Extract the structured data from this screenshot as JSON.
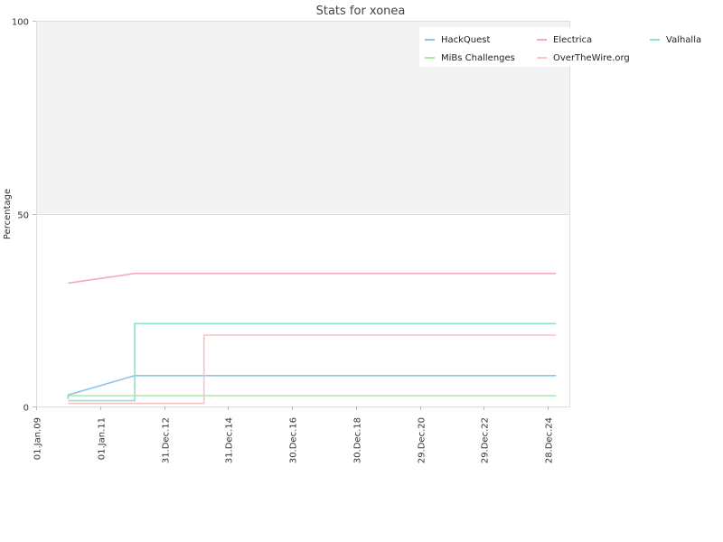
{
  "chart_data": {
    "type": "line",
    "title": "Stats for xonea",
    "xlabel": "",
    "ylabel": "Percentage",
    "ylim": [
      0,
      100
    ],
    "xlim": [
      "2009-01-01",
      "2025-09-01"
    ],
    "y_ticks": [
      0,
      50,
      100
    ],
    "x_ticks": [
      {
        "label": "01.Jan.09",
        "date": "2009-01-01"
      },
      {
        "label": "01.Jan.11",
        "date": "2011-01-01"
      },
      {
        "label": "31.Dec.12",
        "date": "2012-12-31"
      },
      {
        "label": "31.Dec.14",
        "date": "2014-12-31"
      },
      {
        "label": "30.Dec.16",
        "date": "2016-12-30"
      },
      {
        "label": "30.Dec.18",
        "date": "2018-12-30"
      },
      {
        "label": "29.Dec.20",
        "date": "2020-12-29"
      },
      {
        "label": "29.Dec.22",
        "date": "2022-12-29"
      },
      {
        "label": "28.Dec.24",
        "date": "2024-12-28"
      }
    ],
    "shaded_band": {
      "y_from": 50,
      "y_to": 100,
      "color": "#f3f3f3"
    },
    "grid": true,
    "legend_position": "top-right",
    "series": [
      {
        "name": "HackQuest",
        "color": "#8ec3ec",
        "step": false,
        "points": [
          [
            "2010-01-01",
            2
          ],
          [
            "2010-01-01",
            3
          ],
          [
            "2012-02-01",
            8
          ],
          [
            "2025-04-01",
            8
          ]
        ]
      },
      {
        "name": "Electrica",
        "color": "#f2a9c8",
        "step": false,
        "points": [
          [
            "2010-01-01",
            32
          ],
          [
            "2012-02-01",
            34.5
          ],
          [
            "2025-04-01",
            34.5
          ]
        ]
      },
      {
        "name": "Valhalla",
        "color": "#8fe3cf",
        "step": true,
        "points": [
          [
            "2010-01-01",
            1.5
          ],
          [
            "2012-02-01",
            1.5
          ],
          [
            "2012-02-01",
            21.5
          ],
          [
            "2025-04-01",
            21.5
          ]
        ]
      },
      {
        "name": "MiBs Challenges",
        "color": "#a7eba7",
        "step": true,
        "points": [
          [
            "2010-01-01",
            2.8
          ],
          [
            "2025-04-01",
            2.8
          ]
        ]
      },
      {
        "name": "OverTheWire.org",
        "color": "#f7c4c4",
        "step": true,
        "points": [
          [
            "2010-01-01",
            0.8
          ],
          [
            "2014-04-01",
            0.8
          ],
          [
            "2014-04-01",
            18.5
          ],
          [
            "2025-04-01",
            18.5
          ]
        ]
      }
    ]
  }
}
